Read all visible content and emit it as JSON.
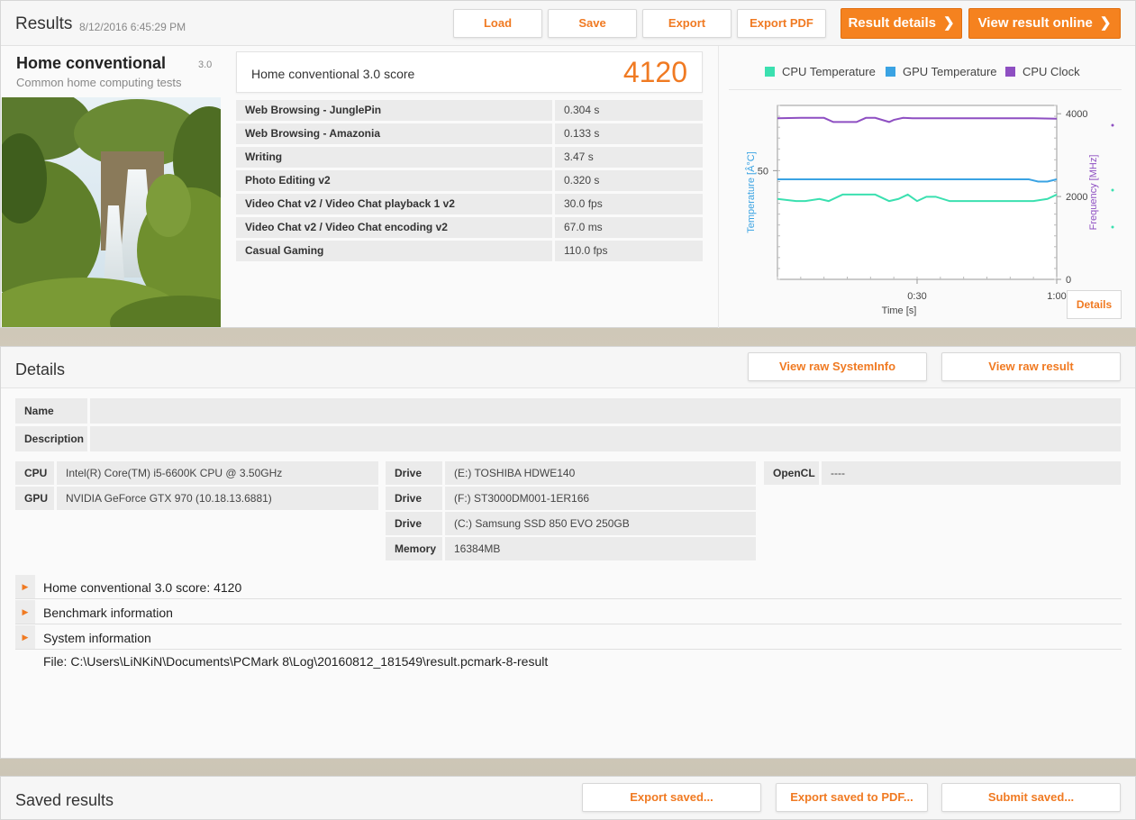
{
  "results": {
    "title": "Results",
    "date": "8/12/2016 6:45:29 PM",
    "buttons": {
      "load": "Load",
      "save": "Save",
      "export": "Export",
      "export_pdf": "Export PDF",
      "result_details": "Result details",
      "view_online": "View result online"
    },
    "benchmark": {
      "name": "Home conventional",
      "version": "3.0",
      "subtitle": "Common home computing tests"
    },
    "score": {
      "label": "Home conventional 3.0 score",
      "value": "4120"
    },
    "tests": [
      {
        "name": "Web Browsing - JunglePin",
        "value": "0.304 s"
      },
      {
        "name": "Web Browsing - Amazonia",
        "value": "0.133 s"
      },
      {
        "name": "Writing",
        "value": "3.47 s"
      },
      {
        "name": "Photo Editing v2",
        "value": "0.320 s"
      },
      {
        "name": "Video Chat v2 / Video Chat playback 1 v2",
        "value": "30.0 fps"
      },
      {
        "name": "Video Chat v2 / Video Chat encoding v2",
        "value": "67.0 ms"
      },
      {
        "name": "Casual Gaming",
        "value": "110.0 fps"
      }
    ],
    "chart_details_button": "Details"
  },
  "chart_data": {
    "type": "line",
    "legend": [
      {
        "name": "CPU Temperature",
        "color": "#3be0b0"
      },
      {
        "name": "GPU Temperature",
        "color": "#3aa3e3"
      },
      {
        "name": "CPU Clock",
        "color": "#8e4fc2"
      }
    ],
    "xlabel": "Time [s]",
    "ylabel_left": "Temperature [Â°C]",
    "ylabel_right": "Frequency [MHz]",
    "x_ticks": [
      "0:30",
      "1:00"
    ],
    "y_left_ticks": [
      "50"
    ],
    "y_right_ticks": [
      "4000",
      "2000",
      "0"
    ],
    "x_range_s": [
      0,
      60
    ],
    "y_left_range": [
      0,
      80
    ],
    "y_right_range": [
      0,
      4200
    ],
    "series": [
      {
        "name": "CPU Temperature",
        "axis": "left",
        "x": [
          0,
          4,
          6,
          9,
          11,
          14,
          17,
          21,
          24,
          26,
          28,
          30,
          32,
          34,
          37,
          40,
          45,
          50,
          55,
          58,
          60
        ],
        "y": [
          37,
          36,
          36,
          37,
          36,
          39,
          39,
          39,
          36,
          37,
          39,
          36,
          38,
          38,
          36,
          36,
          36,
          36,
          36,
          37,
          39
        ]
      },
      {
        "name": "GPU Temperature",
        "axis": "left",
        "x": [
          0,
          10,
          20,
          30,
          40,
          50,
          54,
          56,
          58,
          60
        ],
        "y": [
          46,
          46,
          46,
          46,
          46,
          46,
          46,
          45,
          45,
          46
        ]
      },
      {
        "name": "CPU Clock",
        "axis": "right",
        "x": [
          0,
          5,
          10,
          12,
          15,
          17,
          19,
          21,
          24,
          25,
          27,
          29,
          31,
          35,
          40,
          45,
          50,
          55,
          60
        ],
        "y": [
          3890,
          3900,
          3900,
          3800,
          3800,
          3800,
          3900,
          3900,
          3800,
          3850,
          3900,
          3890,
          3890,
          3890,
          3890,
          3890,
          3890,
          3890,
          3880
        ]
      }
    ]
  },
  "details": {
    "title": "Details",
    "view_raw_sysinfo": "View raw SystemInfo",
    "view_raw_result": "View raw result",
    "name_label": "Name",
    "name_value": "",
    "description_label": "Description",
    "description_value": "",
    "cpu_label": "CPU",
    "cpu_value": "Intel(R) Core(TM) i5-6600K CPU @ 3.50GHz",
    "gpu_label": "GPU",
    "gpu_value": "NVIDIA GeForce GTX 970 (10.18.13.6881)",
    "drives": [
      {
        "label": "Drive",
        "value": "(E:) TOSHIBA HDWE140"
      },
      {
        "label": "Drive",
        "value": "(F:) ST3000DM001-1ER166"
      },
      {
        "label": "Drive",
        "value": "(C:) Samsung SSD 850 EVO 250GB"
      }
    ],
    "memory_label": "Memory",
    "memory_value": "16384MB",
    "opencl_label": "OpenCL",
    "opencl_value": "----",
    "expanders": [
      "Home conventional 3.0 score: 4120",
      "Benchmark information",
      "System information"
    ],
    "file": "File: C:\\Users\\LiNKiN\\Documents\\PCMark 8\\Log\\20160812_181549\\result.pcmark-8-result"
  },
  "saved": {
    "title": "Saved results",
    "export_saved": "Export saved...",
    "export_saved_pdf": "Export saved to PDF...",
    "submit_saved": "Submit saved..."
  }
}
